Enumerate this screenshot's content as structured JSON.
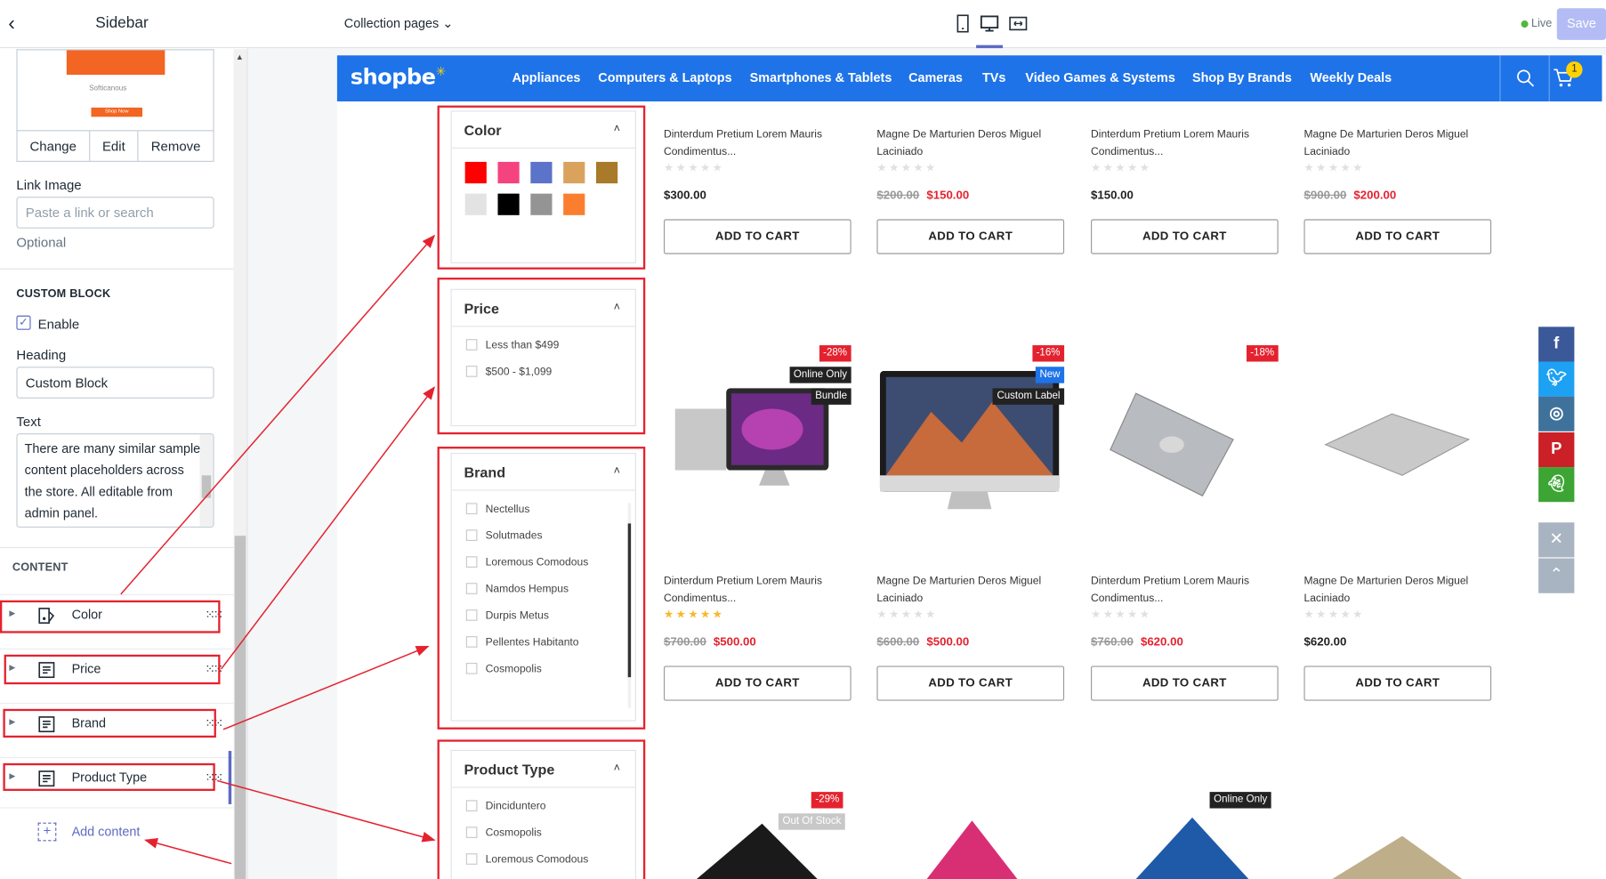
{
  "sidebar": {
    "title": "Sidebar",
    "image_preview": {
      "brand": "Softicanous",
      "button": "Shop Now"
    },
    "image_actions": [
      "Change",
      "Edit",
      "Remove"
    ],
    "link_image": {
      "label": "Link Image",
      "placeholder": "Paste a link or search",
      "help": "Optional"
    },
    "custom_block": {
      "heading": "CUSTOM BLOCK",
      "enable_label": "Enable",
      "enabled": true,
      "heading_label": "Heading",
      "heading_value": "Custom Block",
      "text_label": "Text",
      "text_value": "There are many similar sample content placeholders across the store. All editable from admin panel."
    },
    "content": {
      "heading": "CONTENT",
      "items": [
        {
          "label": "Color",
          "icon": "color-swatch-icon"
        },
        {
          "label": "Price",
          "icon": "text-block-icon"
        },
        {
          "label": "Brand",
          "icon": "text-block-icon"
        },
        {
          "label": "Product Type",
          "icon": "text-block-icon"
        }
      ],
      "add_label": "Add content"
    }
  },
  "topbar": {
    "page_select": "Collection pages",
    "devices": [
      "mobile-icon",
      "desktop-icon",
      "fullwidth-icon"
    ],
    "active_device": "desktop",
    "live_label": "Live",
    "save_label": "Save"
  },
  "store": {
    "logo": "shopbe",
    "nav": [
      "Appliances",
      "Computers & Laptops",
      "Smartphones & Tablets",
      "Cameras",
      "TVs",
      "Video Games & Systems",
      "Shop By Brands",
      "Weekly Deals"
    ],
    "cart_count": "1",
    "accent": "#1e73e8",
    "filters": {
      "color": {
        "title": "Color",
        "swatches": [
          "#ff0000",
          "#f5437f",
          "#5b73c8",
          "#d9a35e",
          "#a87a2a",
          "#e3e3e3",
          "#000000",
          "#949494",
          "#fb7e2e"
        ]
      },
      "price": {
        "title": "Price",
        "options": [
          "Less than $499",
          "$500 - $1,099"
        ]
      },
      "brand": {
        "title": "Brand",
        "options": [
          "Nectellus",
          "Solutmades",
          "Loremous Comodous",
          "Namdos Hempus",
          "Durpis Metus",
          "Pellentes Habitanto",
          "Cosmopolis"
        ]
      },
      "product_type": {
        "title": "Product Type",
        "options": [
          "Dinciduntero",
          "Cosmopolis",
          "Loremous Comodous"
        ]
      }
    },
    "products_row1": [
      {
        "name": "Dinterdum Pretium Lorem Mauris Condimentus...",
        "price": "$300.00",
        "old_price": "",
        "rating": 0
      },
      {
        "name": "Magne De Marturien Deros Miguel Laciniado",
        "price": "$150.00",
        "old_price": "$200.00",
        "rating": 0
      },
      {
        "name": "Dinterdum Pretium Lorem Mauris Condimentus...",
        "price": "$150.00",
        "old_price": "",
        "rating": 0
      },
      {
        "name": "Magne De Marturien Deros Miguel Laciniado",
        "price": "$200.00",
        "old_price": "$900.00",
        "rating": 0
      }
    ],
    "products_row2": [
      {
        "name": "Dinterdum Pretium Lorem Mauris Condimentus...",
        "price": "$500.00",
        "old_price": "$700.00",
        "rating": 4.5,
        "badges": [
          "-28%",
          "Online Only",
          "Bundle"
        ]
      },
      {
        "name": "Magne De Marturien Deros Miguel Laciniado",
        "price": "$500.00",
        "old_price": "$600.00",
        "rating": 0,
        "badges": [
          "-16%",
          "New",
          "Custom Label"
        ]
      },
      {
        "name": "Dinterdum Pretium Lorem Mauris Condimentus...",
        "price": "$620.00",
        "old_price": "$760.00",
        "rating": 0,
        "badges": [
          "-18%"
        ]
      },
      {
        "name": "Magne De Marturien Deros Miguel Laciniado",
        "price": "$620.00",
        "old_price": "",
        "rating": 0,
        "badges": []
      }
    ],
    "row3_badges": {
      "b1": "-29%",
      "b2": "Out Of Stock",
      "b3": "Online Only"
    },
    "add_to_cart": "ADD TO CART",
    "social": [
      "facebook-icon",
      "twitter-icon",
      "instagram-icon",
      "pinterest-icon",
      "snapchat-icon"
    ]
  }
}
